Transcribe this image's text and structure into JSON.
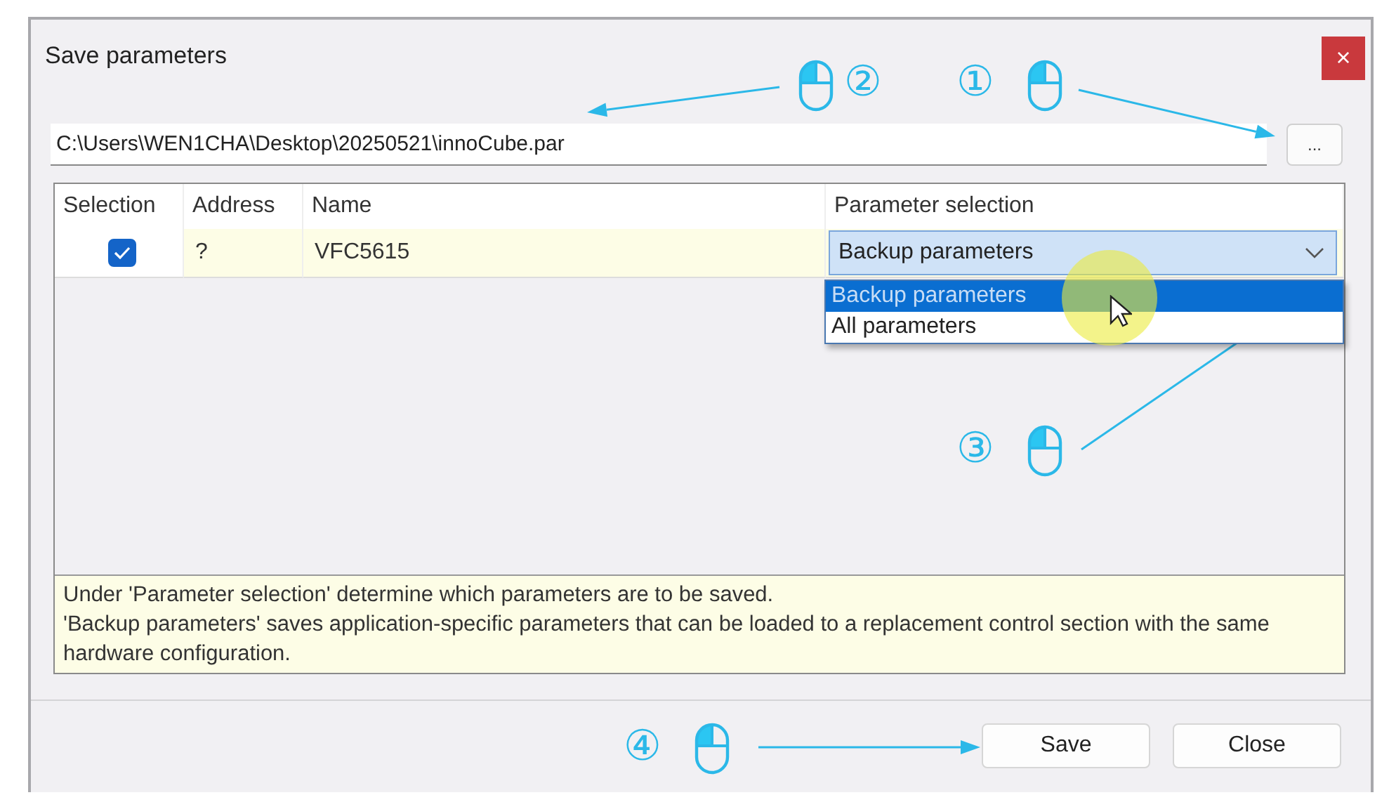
{
  "window": {
    "title": "Save parameters",
    "close_label": "×"
  },
  "file_path": {
    "value": "C:\\Users\\WEN1CHA\\Desktop\\20250521\\innoCube.par"
  },
  "browse_button": "...",
  "table": {
    "columns": [
      "Selection",
      "Address",
      "Name",
      "Parameter selection"
    ],
    "rows": [
      {
        "checked": true,
        "address": "?",
        "name": "VFC5615",
        "parameter_selection": {
          "value": "Backup parameters",
          "expanded": true,
          "options": [
            {
              "label": "Backup parameters",
              "selected": true
            },
            {
              "label": "All parameters",
              "selected": false
            }
          ]
        }
      }
    ]
  },
  "description": [
    "Under 'Parameter selection' determine which parameters are to be saved.",
    "'Backup parameters' saves application-specific parameters that can be loaded to a replacement control section with the same hardware configuration."
  ],
  "buttons": [
    "Save",
    "Close"
  ],
  "annotations": [
    {
      "step": "②"
    },
    {
      "step": "①"
    },
    {
      "step": "③"
    },
    {
      "step": "④"
    }
  ]
}
